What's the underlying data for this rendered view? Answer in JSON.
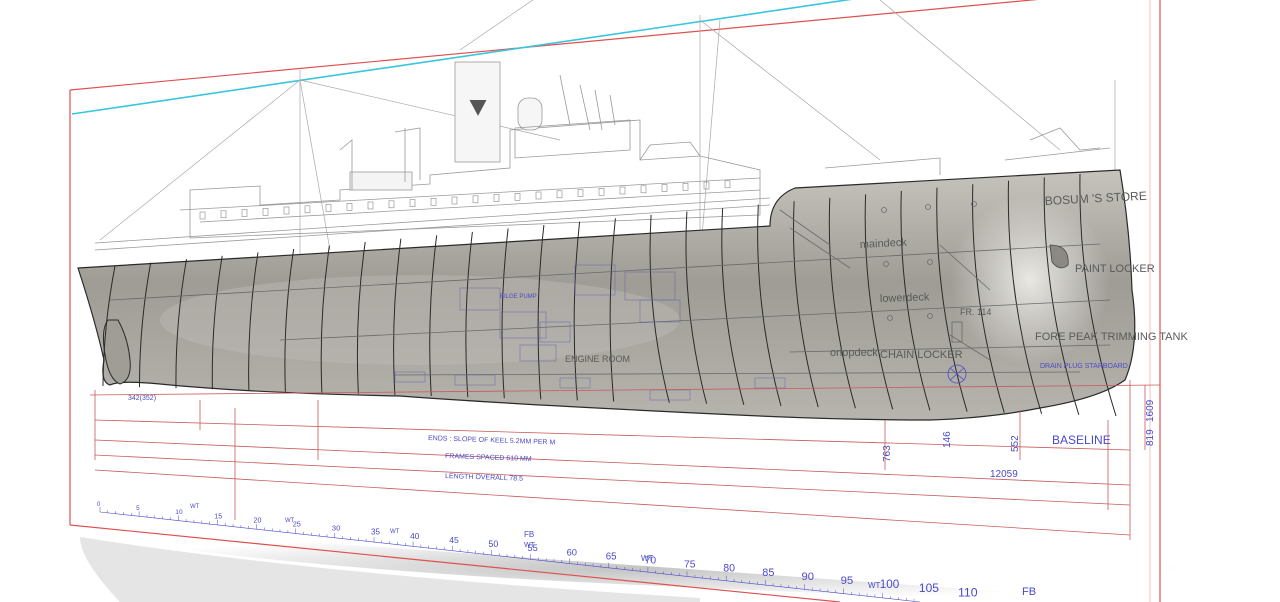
{
  "colors": {
    "sheet_border": "#e05050",
    "waterline": "#39c5dd",
    "dimension": "#c85a5a",
    "plan_line": "#9a9a9a",
    "plan_text": "#4a4ac8",
    "hull_fill": "#a9a6a0",
    "hull_stroke": "#2a2a2a"
  },
  "hull_labels": {
    "bosuns_store": "BOSUM 'S STORE",
    "main_deck": "maindeck",
    "lower_deck": "lowerdeck",
    "orlop_deck": "orlopdeck",
    "chain_locker": "CHAIN LOCKER",
    "paint_locker": "PAINT LOCKER",
    "fore_peak": "FORE PEAK TRIMMING TANK",
    "frame_ref": "FR. 114",
    "drain_plug": "DRAIN PLUG STARBOARD"
  },
  "plan_labels": {
    "engine_room": "ENGINE ROOM",
    "bilge_pump": "BILGE PUMP",
    "keel_slope": "ENDS : SLOPE OF KEEL 5.2MM PER M",
    "frames_spaced": "FRAMES SPACED 610 MM",
    "length_overall": "LENGTH OVERALL 78.5",
    "baseline": "BASELINE"
  },
  "dimensions": {
    "d_763": "763",
    "d_146": "146",
    "d_552": "552",
    "d_12059": "12059",
    "d_1609": "1609",
    "d_819": "819",
    "d_342": "342(352)"
  },
  "frame_scale": {
    "numbers": [
      "0",
      "5",
      "10",
      "15",
      "20",
      "25",
      "30",
      "35",
      "40",
      "45",
      "50",
      "55",
      "60",
      "65",
      "70",
      "75",
      "80",
      "85",
      "90",
      "95",
      "100",
      "105",
      "110"
    ],
    "wt": "WT",
    "fb": "FB"
  }
}
